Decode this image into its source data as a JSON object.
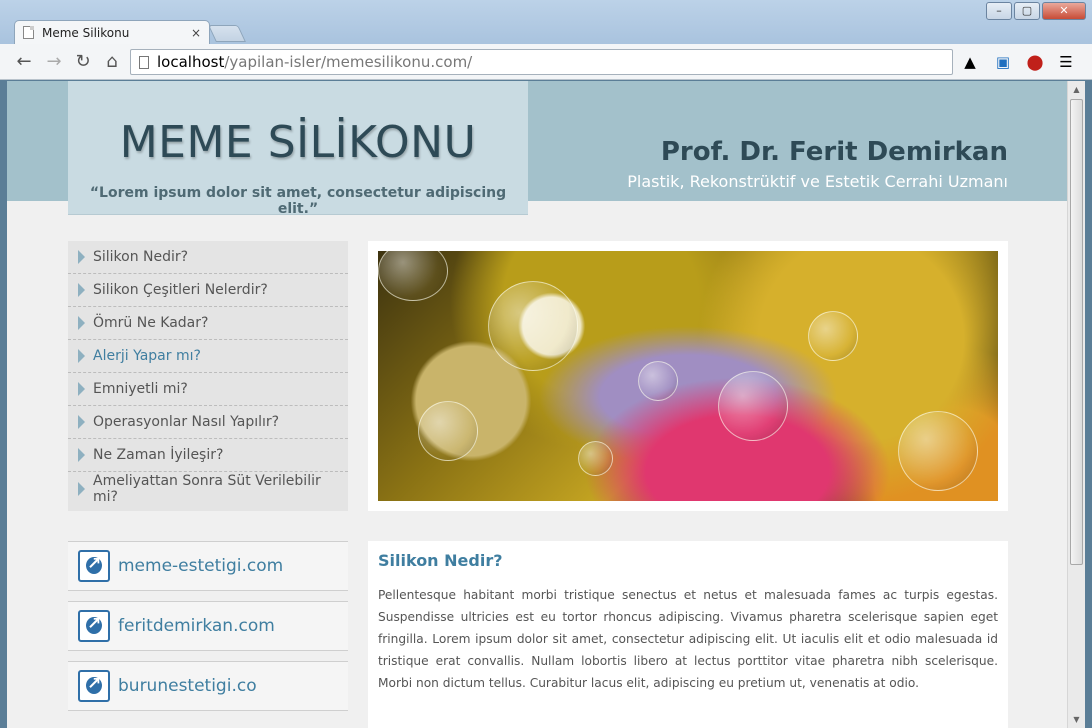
{
  "browser": {
    "tab_title": "Meme Silikonu",
    "tab_close": "×",
    "url_host": "localhost",
    "url_path": "/yapilan-isler/memesilikonu.com/",
    "window_minimize": "–",
    "window_maximize": "▢",
    "window_close": "✕"
  },
  "header": {
    "logo_title": "MEME SİLİKONU",
    "slogan": "“Lorem ipsum dolor sit amet, consectetur adipiscing elit.”",
    "doctor_name": "Prof. Dr. Ferit Demirkan",
    "doctor_title": "Plastik, Rekonstrüktif ve Estetik Cerrahi Uzmanı"
  },
  "menu": {
    "items": [
      {
        "label": "Silikon Nedir?"
      },
      {
        "label": "Silikon Çeşitleri Nelerdir?"
      },
      {
        "label": "Ömrü Ne Kadar?"
      },
      {
        "label": "Alerji Yapar mı?"
      },
      {
        "label": "Emniyetli mi?"
      },
      {
        "label": "Operasyonlar Nasıl Yapılır?"
      },
      {
        "label": "Ne Zaman İyileşir?"
      },
      {
        "label": "Ameliyattan Sonra Süt Verilebilir mi?"
      }
    ],
    "active_index": 3
  },
  "links": [
    {
      "label": "meme-estetigi.com"
    },
    {
      "label": "feritdemirkan.com"
    },
    {
      "label": "burunestetigi.co"
    }
  ],
  "article": {
    "title": "Silikon Nedir?",
    "body": "Pellentesque habitant morbi tristique senectus et netus et malesuada fames ac turpis egestas. Suspendisse ultricies est eu tortor rhoncus adipiscing. Vivamus pharetra scelerisque sapien eget fringilla. Lorem ipsum dolor sit amet, consectetur adipiscing elit. Ut iaculis elit et odio malesuada id tristique erat convallis. Nullam lobortis libero at lectus porttitor vitae pharetra nibh scelerisque. Morbi non dictum tellus. Curabitur lacus elit, adipiscing eu pretium ut, venenatis at odio."
  },
  "colors": {
    "header_band": "#a3c1cb",
    "logo_box": "#c9dbe2",
    "accent": "#3f7ea0",
    "dark_text": "#2e4a56"
  }
}
